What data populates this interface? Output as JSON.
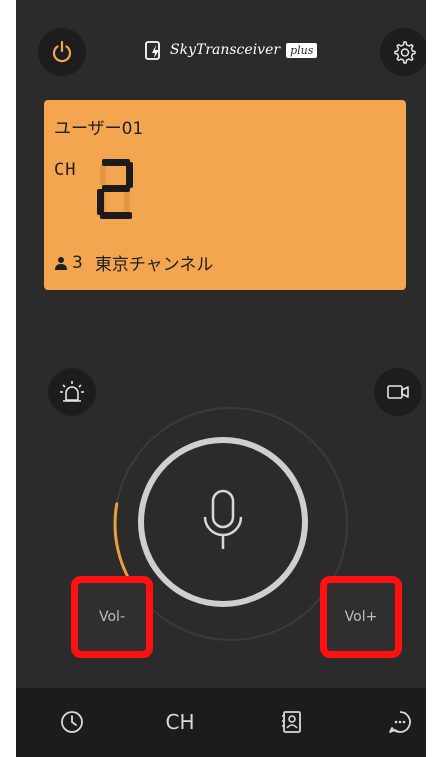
{
  "app": {
    "logo_text": "SkyTransceiver",
    "logo_badge": "plus"
  },
  "display": {
    "user": "ユーザー01",
    "ch_label": "CH",
    "channel_number": "2",
    "member_count": "3",
    "channel_name": "東京チャンネル",
    "background_color": "#f3a64f"
  },
  "controls": {
    "vol_minus": "Vol-",
    "vol_plus": "Vol+",
    "volume_level": 0.25
  },
  "nav": {
    "history_icon": "clock-icon",
    "ch_label": "CH",
    "contacts_icon": "contacts-icon",
    "chat_icon": "chat-bubble-icon"
  },
  "colors": {
    "accent_orange": "#e8a040",
    "highlight_red": "#ff1111"
  }
}
